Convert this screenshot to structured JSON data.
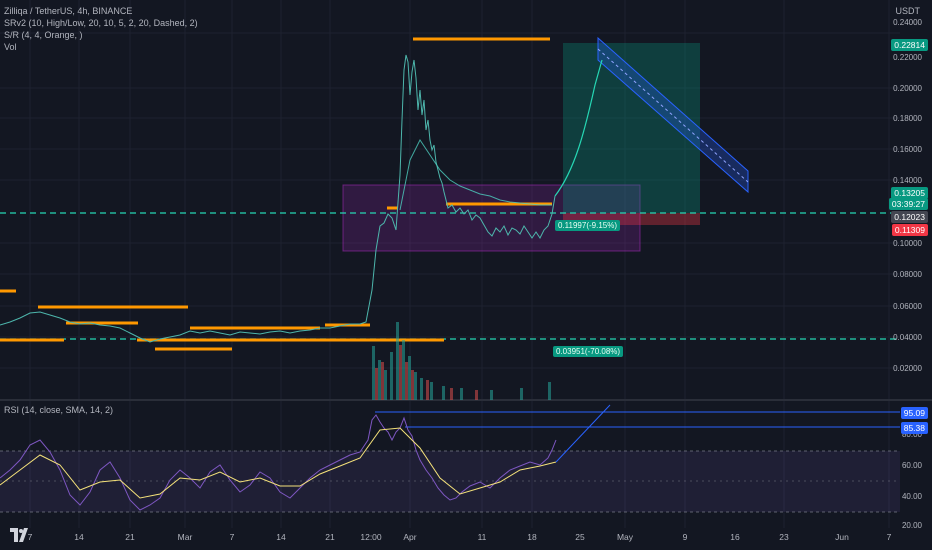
{
  "header": {
    "symbol_line": "Zilliqa / TetherUS, 4h, BINANCE",
    "indicator_srv2": "SRv2 (10, High/Low, 20, 10, 5, 2, 20, Dashed, 2)",
    "indicator_sr": "S/R (4, 4, Orange, )",
    "indicator_vol": "Vol",
    "currency": "USDT"
  },
  "price_axis": {
    "labels": [
      "0.24000",
      "0.22000",
      "0.20000",
      "0.18000",
      "0.16000",
      "0.14000",
      "0.10000",
      "0.08000",
      "0.06000",
      "0.04000",
      "0.02000"
    ]
  },
  "price_badges": {
    "target": "0.22814",
    "current_price": "0.13205",
    "countdown": "03:39:27",
    "entry": "0.12023",
    "stop": "0.11309"
  },
  "annotations": {
    "upper_tag": "0.11997(-9.15%)",
    "lower_tag": "0.03951(-70.08%)"
  },
  "rsi": {
    "legend": "RSI (14, close, SMA, 14, 2)",
    "axis_labels": [
      "80.00",
      "60.00",
      "40.00",
      "20.00"
    ],
    "badge_high": "95.09",
    "badge_low": "85.38"
  },
  "time_axis": {
    "labels": [
      "7",
      "14",
      "21",
      "Mar",
      "7",
      "14",
      "21",
      "12:00",
      "Apr",
      "11",
      "18",
      "25",
      "May",
      "9",
      "16",
      "23",
      "Jun",
      "7"
    ]
  },
  "colors": {
    "background": "#131722",
    "sr_orange": "#ff9800",
    "cyan_dashed": "#26d7b4",
    "green_badge": "#089981",
    "red_badge": "#f23645",
    "rsi_line": "#7e57c2",
    "rsi_ma": "#f5e27a",
    "range_box": "#9c27b0",
    "channel_blue": "#2962ff"
  }
}
